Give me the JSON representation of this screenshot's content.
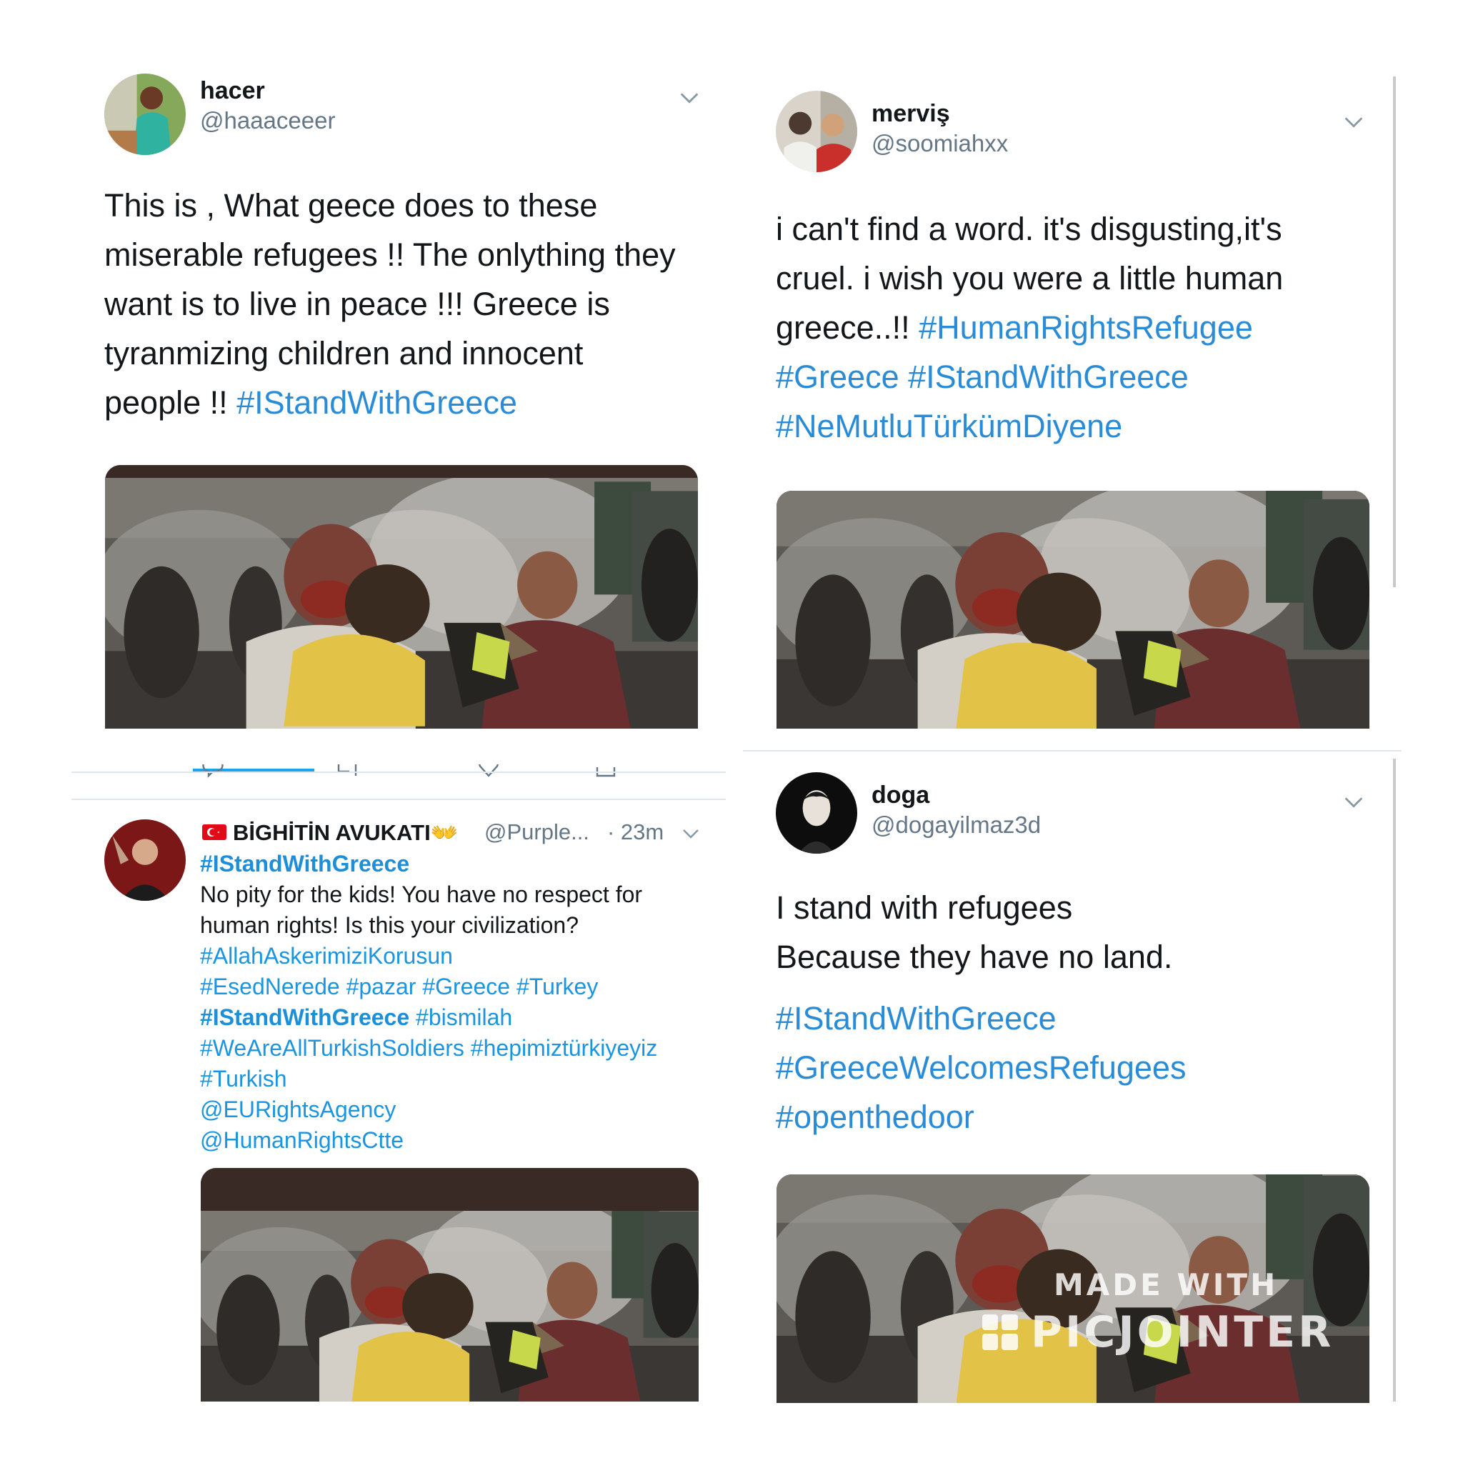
{
  "tweets": {
    "hacer": {
      "name": "hacer",
      "handle": "@haaaceeer",
      "text_lines": [
        "This is , What geece does to these",
        "miserable refugees !! The onlything they",
        "want is to live in peace !!!  Greece is",
        "tyranmizing  children and innocent",
        "people !! "
      ],
      "hashtag": "#IStandWithGreece"
    },
    "mervis": {
      "name": "merviş",
      "handle": "@soomiahxx",
      "text_lines": [
        "i can't find a word. it's disgusting,it's",
        "cruel.  i wish you were a little human",
        "greece..!! "
      ],
      "hashtags": [
        "#HumanRightsRefugee",
        "#Greece",
        "#IStandWithGreece",
        "#NeMutluTürkümDiyene"
      ]
    },
    "avukati": {
      "name": "BİGHİTİN AVUKATI",
      "name_emoji": "👐",
      "handle": "@Purple...",
      "time": "· 23m",
      "top_hashtag": "#IStandWithGreece",
      "text_line1": "No pity for the kids! You have no respect for",
      "text_line2": "human rights! Is this your civilization?",
      "tags": {
        "allah": "#AllahAskerimiziKorusun",
        "esed": "#EsedNerede",
        "pazar": "#pazar",
        "greece": "#Greece",
        "turkey": "#Turkey",
        "istand": "#IStandWithGreece",
        "bismilah": "#bismilah",
        "soldiers": "#WeAreAllTurkishSoldiers",
        "hepimiz": "#hepimiztürkiyeyiz",
        "turkish": "#Turkish"
      },
      "mentions": [
        "@EURightsAgency",
        "@HumanRightsCtte"
      ]
    },
    "doga": {
      "name": "doga",
      "handle": "@dogayilmaz3d",
      "text_lines": [
        "I stand with refugees",
        "Because they have no land."
      ],
      "hashtags": [
        "#IStandWithGreece",
        "#GreeceWelcomesRefugees",
        "#openthedoor"
      ]
    }
  },
  "watermark": {
    "line1": "MADE WITH",
    "line2": "PICJOINTER"
  },
  "icons": [
    "chevron-down-icon",
    "reply-icon",
    "retweet-icon",
    "like-icon",
    "share-icon",
    "turkey-flag-icon"
  ],
  "colors": {
    "link": "#1b95e0",
    "text": "#14171a",
    "muted": "#657786"
  }
}
